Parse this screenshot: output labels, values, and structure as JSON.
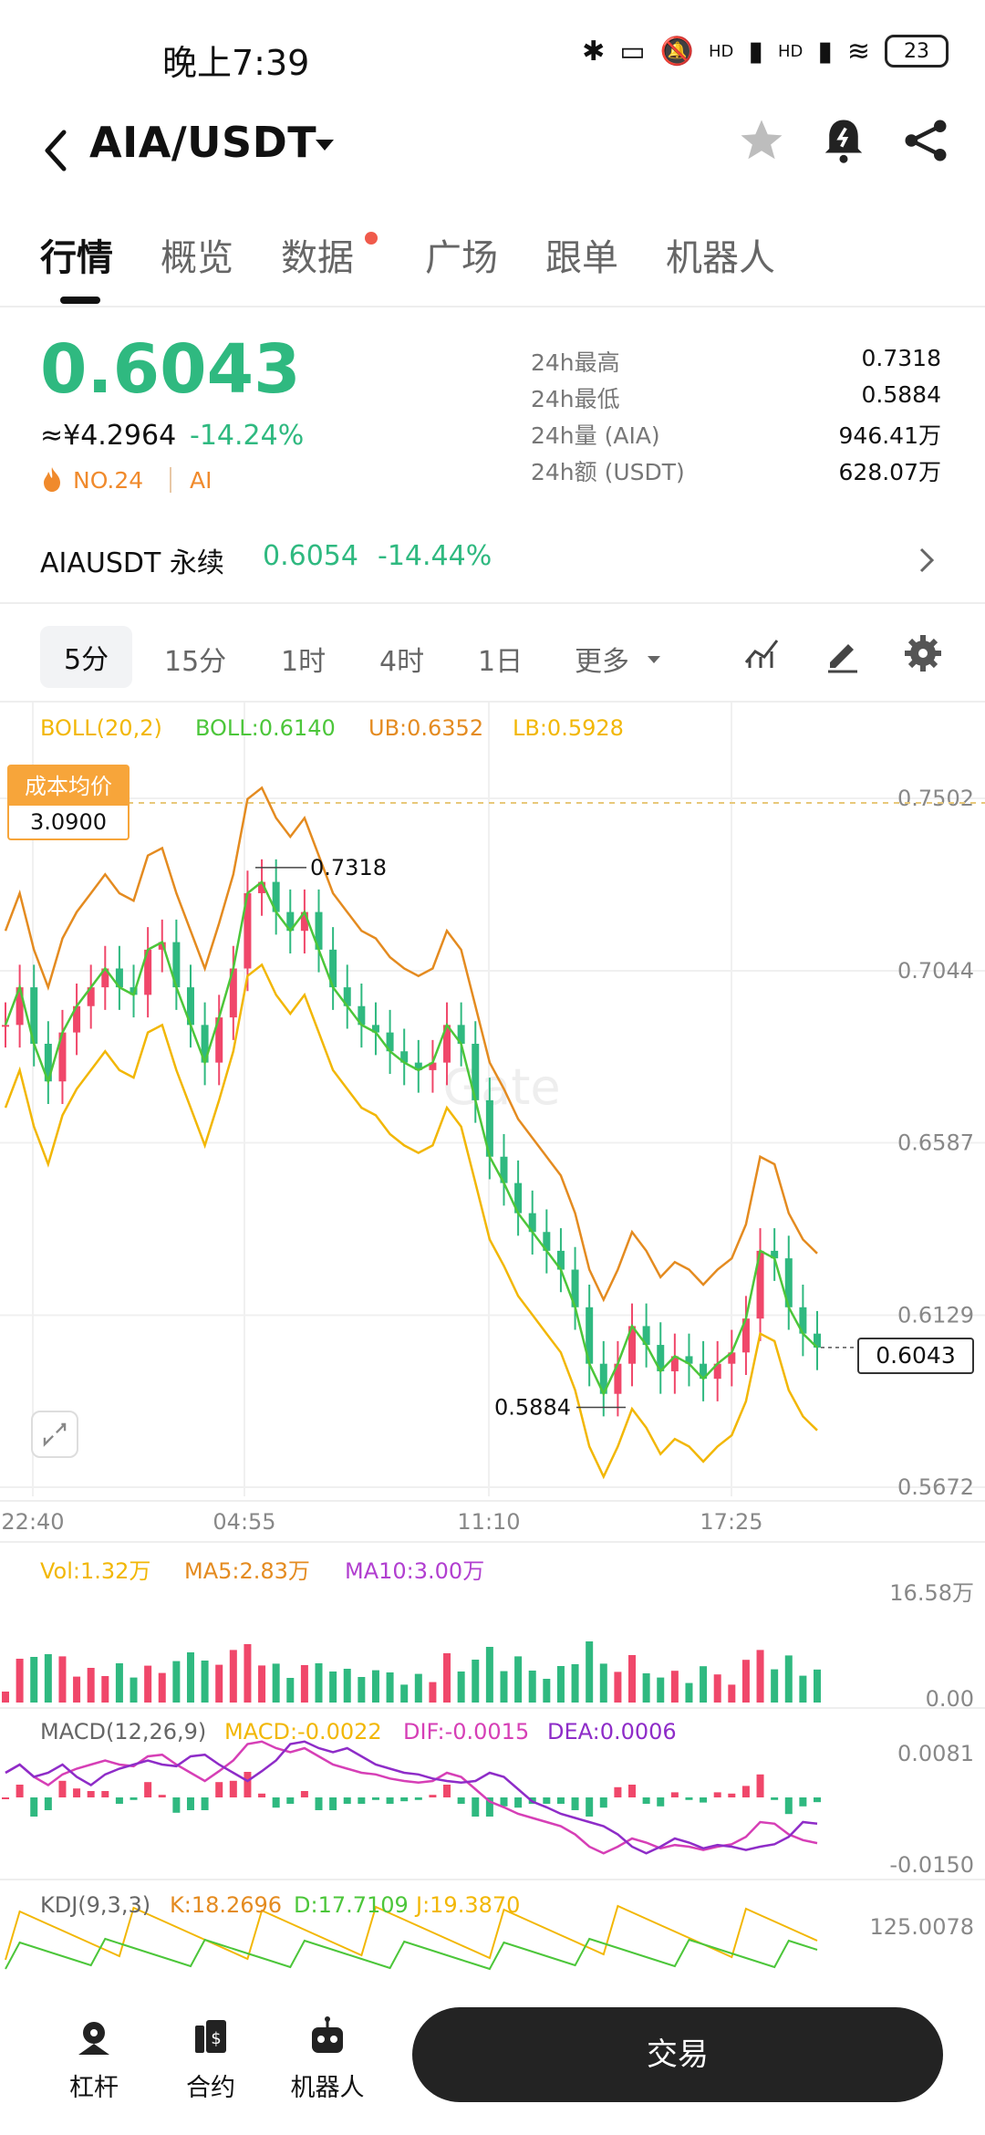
{
  "status_bar": {
    "time": "晚上7:39",
    "battery": "23",
    "network_1": "HD",
    "network_2": "HD"
  },
  "header": {
    "title": "AIA/USDT"
  },
  "tabs": [
    {
      "label": "行情",
      "active": true
    },
    {
      "label": "概览"
    },
    {
      "label": "数据",
      "dot": true
    },
    {
      "label": "广场"
    },
    {
      "label": "跟单"
    },
    {
      "label": "机器人"
    }
  ],
  "ticker": {
    "price": "0.6043",
    "cny": "≈¥4.2964",
    "change": "-14.24%",
    "rank": "NO.24",
    "tag": "AI",
    "stats": [
      {
        "label": "24h最高",
        "value": "0.7318"
      },
      {
        "label": "24h最低",
        "value": "0.5884"
      },
      {
        "label": "24h量 (AIA)",
        "value": "946.41万"
      },
      {
        "label": "24h额 (USDT)",
        "value": "628.07万"
      }
    ]
  },
  "perpetual": {
    "name": "AIAUSDT 永续",
    "price": "0.6054",
    "change": "-14.44%"
  },
  "intervals": [
    "5分",
    "15分",
    "1时",
    "4时",
    "1日",
    "更多"
  ],
  "indicators": {
    "boll": {
      "name": "BOLL(20,2)",
      "mid": "BOLL:0.6140",
      "ub": "UB:0.6352",
      "lb": "LB:0.5928"
    },
    "vol": {
      "vol": "Vol:1.32万",
      "ma5": "MA5:2.83万",
      "ma10": "MA10:3.00万",
      "max": "16.58万",
      "min": "0.00"
    },
    "macd": {
      "name": "MACD(12,26,9)",
      "macd": "MACD:-0.0022",
      "dif": "DIF:-0.0015",
      "dea": "DEA:0.0006",
      "max": "0.0081",
      "min": "-0.0150"
    },
    "kdj": {
      "name": "KDJ(9,3,3)",
      "k": "K:18.2696",
      "d": "D:17.7109",
      "j": "J:19.3870",
      "max": "125.0078"
    }
  },
  "cost_tag": {
    "label": "成本均价",
    "value": "3.0900"
  },
  "colors": {
    "up": "#f0476a",
    "down": "#2fb980",
    "ma_mid": "#4cc63a",
    "band_upper": "#e48b20",
    "band_lower": "#f2b705",
    "macd_dif": "#d63fb6",
    "macd_dea": "#8e2cc8"
  },
  "chart_data": {
    "type": "candlestick",
    "price_axis": [
      "0.7502",
      "0.7044",
      "0.6587",
      "0.6129",
      "0.5672"
    ],
    "ylim": [
      0.5672,
      0.7502
    ],
    "time_axis": [
      "22:40",
      "04:55",
      "11:10",
      "17:25"
    ],
    "high_marker": "0.7318",
    "low_marker": "0.5884",
    "last_price": "0.6043",
    "close_series": [
      0.69,
      0.7,
      0.685,
      0.675,
      0.688,
      0.695,
      0.7,
      0.705,
      0.7,
      0.698,
      0.71,
      0.712,
      0.7,
      0.69,
      0.68,
      0.692,
      0.705,
      0.725,
      0.728,
      0.72,
      0.715,
      0.72,
      0.71,
      0.7,
      0.695,
      0.69,
      0.688,
      0.683,
      0.68,
      0.678,
      0.68,
      0.69,
      0.685,
      0.67,
      0.655,
      0.648,
      0.64,
      0.635,
      0.63,
      0.625,
      0.615,
      0.6,
      0.592,
      0.6,
      0.61,
      0.605,
      0.598,
      0.602,
      0.6,
      0.596,
      0.6,
      0.603,
      0.612,
      0.63,
      0.628,
      0.615,
      0.608,
      0.6043
    ]
  }
}
